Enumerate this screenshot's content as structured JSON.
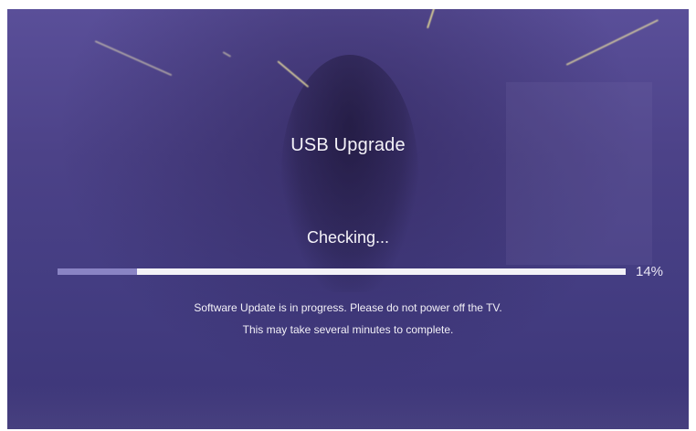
{
  "dialog": {
    "title": "USB Upgrade",
    "status": "Checking...",
    "progress": {
      "percent_value": 0.14,
      "percent_label": "14%",
      "track_color": "#f3f2f7",
      "fill_color": "#8a84c4"
    },
    "messages": [
      "Software Update is in progress. Please do not power off the TV.",
      "This may take several minutes to complete."
    ]
  },
  "screen": {
    "background_color": "#4c4288",
    "text_color": "#f4f2f8"
  }
}
